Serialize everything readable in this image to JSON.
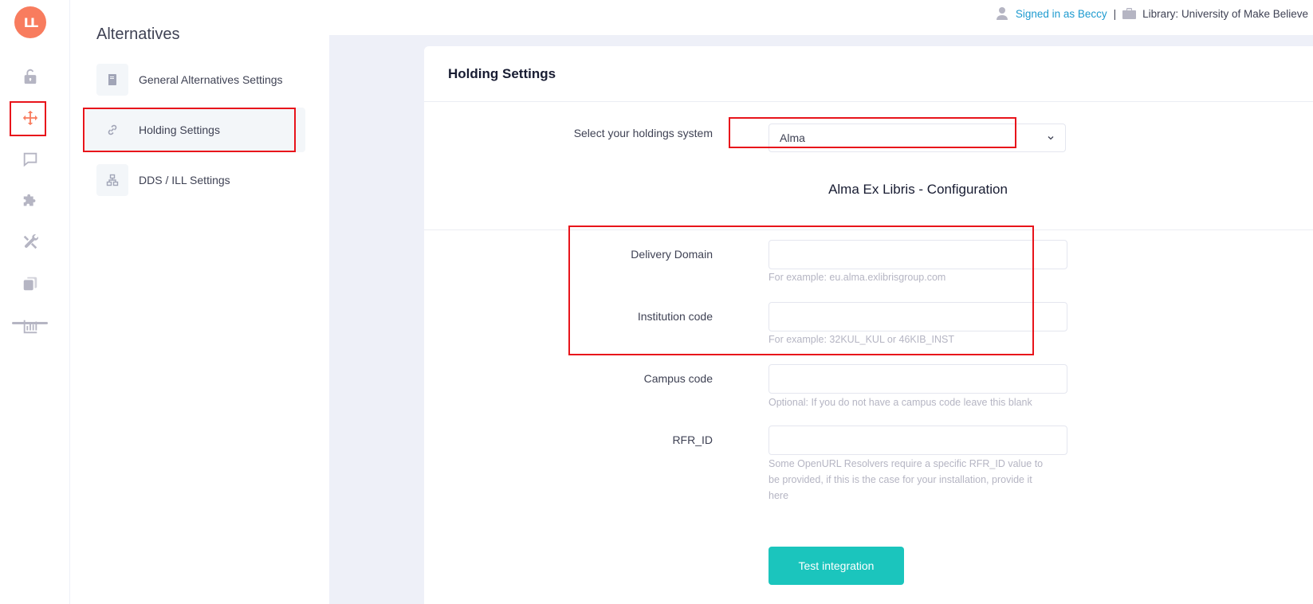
{
  "app": {
    "logo_text": "LL",
    "accent_color": "#f87c5e"
  },
  "rail": {
    "items": [
      {
        "name": "unlock-icon",
        "active": false
      },
      {
        "name": "move-arrows-icon",
        "active": true
      },
      {
        "name": "chat-bubble-icon",
        "active": false
      },
      {
        "name": "puzzle-icon",
        "active": false
      },
      {
        "name": "tools-icon",
        "active": false
      },
      {
        "name": "copies-icon",
        "active": false
      },
      {
        "name": "bar-chart-icon",
        "active": false
      }
    ]
  },
  "topbar": {
    "signed_in": "Signed in as Beccy",
    "separator": "|",
    "library": "Library: University of Make Believe"
  },
  "submenu": {
    "title": "Alternatives",
    "items": [
      {
        "label": "General Alternatives Settings",
        "icon": "book-icon",
        "active": false
      },
      {
        "label": "Holding Settings",
        "icon": "link-icon",
        "active": true
      },
      {
        "label": "DDS / ILL Settings",
        "icon": "network-icon",
        "active": false
      }
    ]
  },
  "card": {
    "title": "Holding Settings",
    "holdings_label": "Select your holdings system",
    "holdings_value": "Alma",
    "section_title": "Alma Ex Libris - Configuration",
    "fields": [
      {
        "label": "Delivery Domain",
        "value": "",
        "help": "For example: eu.alma.exlibrisgroup.com"
      },
      {
        "label": "Institution code",
        "value": "",
        "help": "For example: 32KUL_KUL or 46KIB_INST"
      },
      {
        "label": "Campus code",
        "value": "",
        "help": "Optional: If you do not have a campus code leave this blank"
      },
      {
        "label": "RFR_ID",
        "value": "",
        "help": "Some OpenURL Resolvers require a specific RFR_ID value to be provided, if this is the case for your installation, provide it here"
      }
    ],
    "test_button": "Test integration"
  },
  "colors": {
    "highlight": "#e8141b",
    "button": "#1bc5bd",
    "link": "#1e9bd0"
  }
}
